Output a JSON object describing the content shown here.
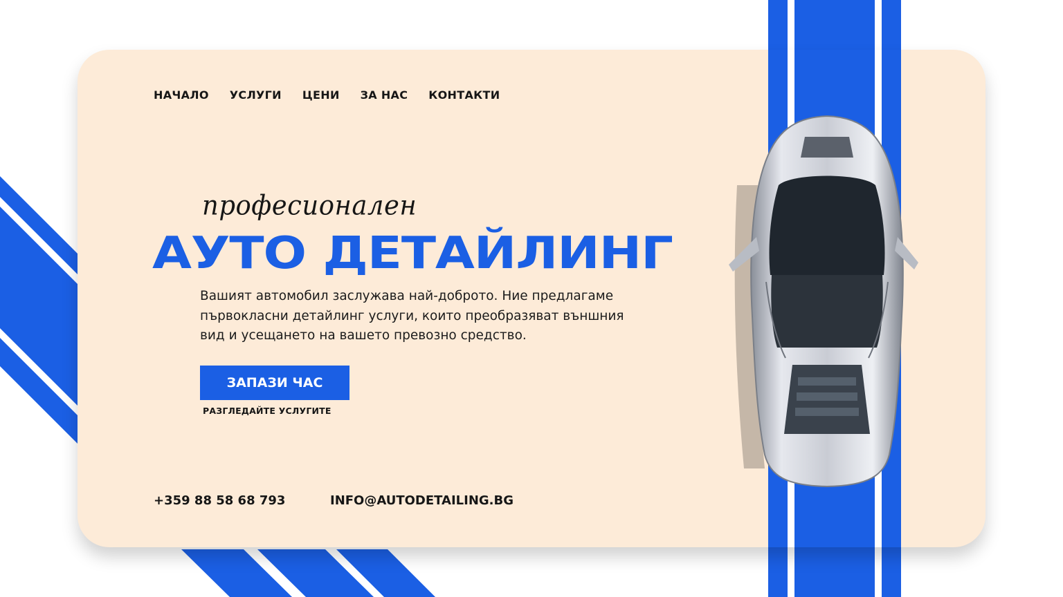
{
  "nav": {
    "items": [
      {
        "label": "НАЧАЛО"
      },
      {
        "label": "УСЛУГИ"
      },
      {
        "label": "ЦЕНИ"
      },
      {
        "label": "ЗА НАС"
      },
      {
        "label": "КОНТАКТИ"
      }
    ]
  },
  "hero": {
    "script_text": "професионален",
    "headline": "АУТО ДЕТАЙЛИНГ",
    "description": "Вашият автомобил заслужава най-доброто. Ние предлагаме първокласни детайлинг услуги, които преобразяват външния вид и усещането на вашето превозно средство.",
    "cta_label": "ЗАПАЗИ ЧАС",
    "secondary_link": "РАЗГЛЕДАЙТЕ УСЛУГИТЕ"
  },
  "contact": {
    "phone": "+359 88 58 68 793",
    "email": "INFO@AUTODETAILING.BG"
  },
  "colors": {
    "accent": "#1b5fe4",
    "card_background": "#fdebd8",
    "page_background": "#ffffff",
    "text": "#161616"
  },
  "images": {
    "car": "silver-sports-car-top-view"
  }
}
